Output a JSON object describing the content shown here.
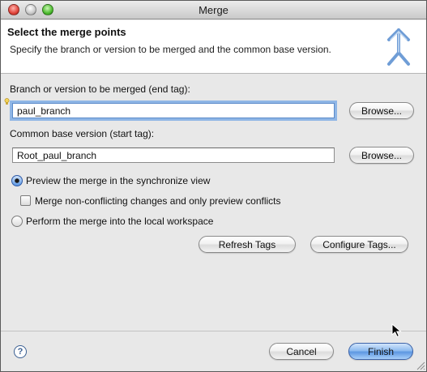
{
  "window": {
    "title": "Merge"
  },
  "banner": {
    "title": "Select the merge points",
    "description": "Specify the branch or version to be merged and the common base version.",
    "icon": "merge-arrows-icon"
  },
  "end_tag": {
    "label": "Branch or version to be merged (end tag):",
    "value": "paul_branch",
    "browse_label": "Browse..."
  },
  "start_tag": {
    "label": "Common base version (start tag):",
    "value": "Root_paul_branch",
    "browse_label": "Browse..."
  },
  "options": {
    "preview": {
      "label": "Preview the merge in the synchronize view",
      "selected": true
    },
    "non_conflicting": {
      "label": "Merge non-conflicting changes and only preview conflicts",
      "checked": false
    },
    "perform": {
      "label": "Perform the merge into the local workspace",
      "selected": false
    }
  },
  "tag_buttons": {
    "refresh": "Refresh Tags",
    "configure": "Configure Tags..."
  },
  "footer": {
    "help_glyph": "?",
    "cancel": "Cancel",
    "finish": "Finish"
  },
  "colors": {
    "accent": "#5d97e2",
    "focus_ring": "#8fb6e6"
  }
}
